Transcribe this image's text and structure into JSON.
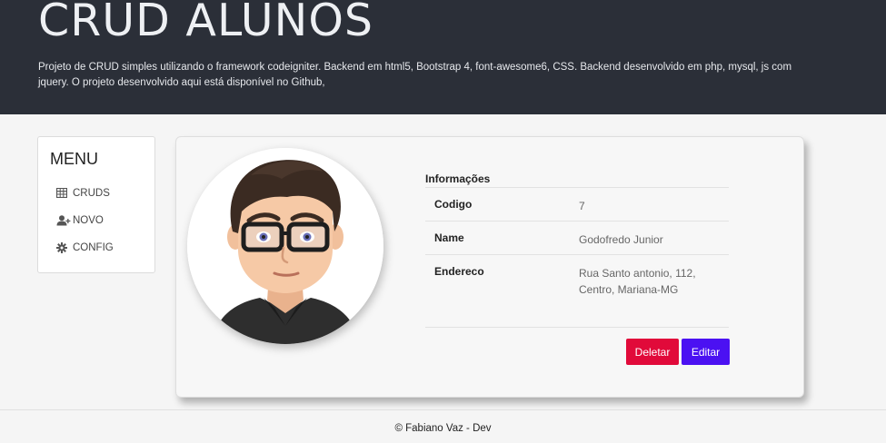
{
  "header": {
    "title": "CRUD ALUNOS",
    "description": "Projeto de CRUD simples utilizando o framework codeigniter. Backend em html5, Bootstrap 4, font-awesome6, CSS. Backend desenvolvido em php, mysql, js com jquery. O projeto desenvolvido aqui está disponível no Github,"
  },
  "menu": {
    "title": "MENU",
    "items": [
      {
        "label": "CRUDS",
        "icon": "table-icon"
      },
      {
        "label": "NOVO",
        "icon": "user-plus-icon"
      },
      {
        "label": "CONFIG",
        "icon": "gear-icon"
      }
    ]
  },
  "profile": {
    "avatar": "avatar-image",
    "caption": "Informações",
    "fields": [
      {
        "key": "Codigo",
        "value": "7"
      },
      {
        "key": "Name",
        "value": "Godofredo Junior"
      },
      {
        "key": "Endereco",
        "value": "Rua Santo antonio, 112, Centro, Mariana-MG"
      }
    ],
    "delete_label": "Deletar",
    "edit_label": "Editar"
  },
  "colors": {
    "header_bg": "#2b2f38",
    "delete": "#e10a3a",
    "edit": "#4b11f2"
  },
  "footer": {
    "text": "© Fabiano Vaz - Dev"
  }
}
